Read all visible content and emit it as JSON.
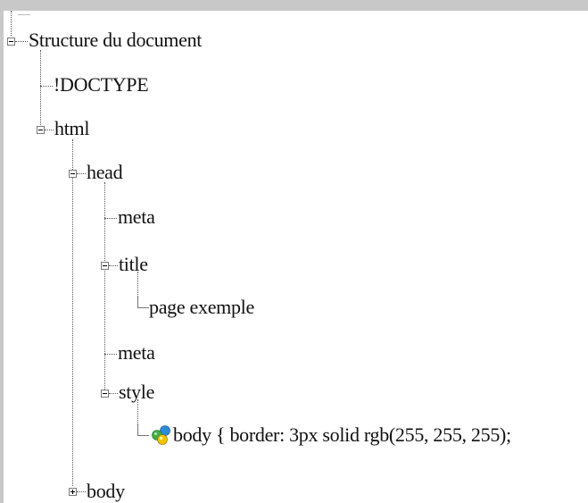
{
  "tree": {
    "root_label": "Structure du document",
    "doctype_label": "!DOCTYPE",
    "html_label": "html",
    "head_label": "head",
    "meta1_label": "meta",
    "title_label": "title",
    "title_text_label": "page exemple",
    "meta2_label": "meta",
    "style_label": "style",
    "style_rule_label": "body { border: 3px solid rgb(255, 255, 255);",
    "body_label": "body"
  }
}
